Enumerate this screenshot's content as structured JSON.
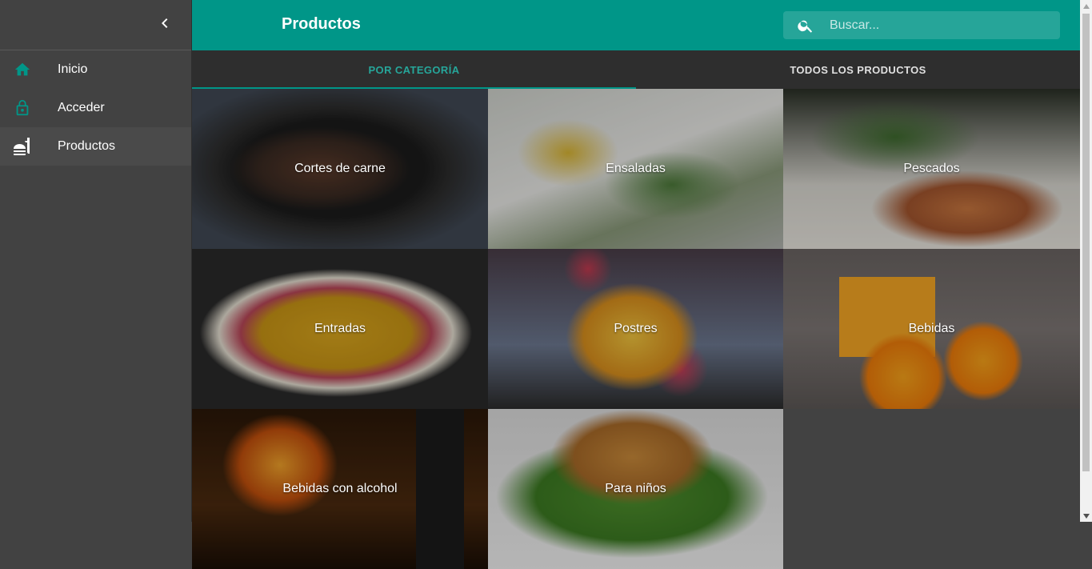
{
  "appbar": {
    "title": "Productos"
  },
  "search": {
    "placeholder": "Buscar..."
  },
  "sidebar": {
    "items": [
      {
        "label": "Inicio",
        "icon": "home-icon"
      },
      {
        "label": "Acceder",
        "icon": "lock-icon"
      },
      {
        "label": "Productos",
        "icon": "food-icon"
      }
    ]
  },
  "tabs": [
    {
      "label": "POR CATEGORÍA",
      "active": true
    },
    {
      "label": "TODOS LOS PRODUCTOS",
      "active": false
    }
  ],
  "categories": [
    {
      "label": "Cortes de carne"
    },
    {
      "label": "Ensaladas"
    },
    {
      "label": "Pescados"
    },
    {
      "label": "Entradas"
    },
    {
      "label": "Postres"
    },
    {
      "label": "Bebidas"
    },
    {
      "label": "Bebidas con alcohol"
    },
    {
      "label": "Para niños"
    }
  ],
  "colors": {
    "primary": "#009688",
    "accent": "#26a69a",
    "sidebar": "#424242",
    "tabs_bg": "#2e2e2e"
  }
}
